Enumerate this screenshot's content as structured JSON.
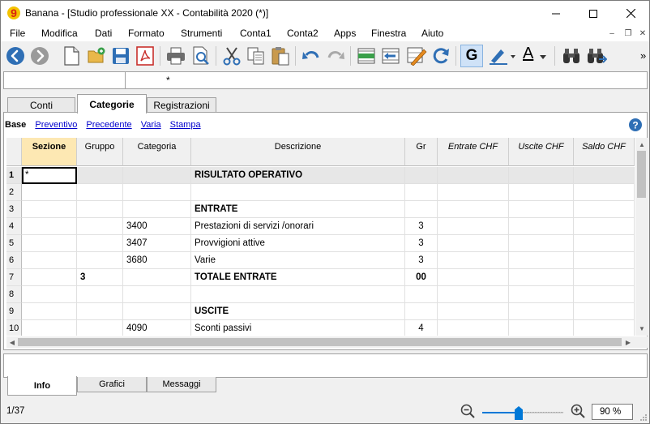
{
  "window": {
    "title": "Banana - [Studio professionale XX - Contabilità 2020 (*)]",
    "logo_glyph": "9"
  },
  "menu": [
    "File",
    "Modifica",
    "Dati",
    "Formato",
    "Strumenti",
    "Conta1",
    "Conta2",
    "Apps",
    "Finestra",
    "Aiuto"
  ],
  "toolbar": {
    "icons": [
      "back-icon",
      "forward-icon",
      "new-file-icon",
      "open-folder-icon",
      "save-icon",
      "pdf-icon",
      "print-icon",
      "print-preview-icon",
      "cut-icon",
      "copy-icon",
      "paste-icon",
      "undo-icon",
      "redo-icon",
      "insert-rows-icon",
      "delete-rows-icon",
      "edit-icon",
      "refresh-icon",
      "bold-icon",
      "highlight-icon",
      "text-color-icon",
      "find-icon",
      "find-next-icon"
    ],
    "bold_label": "G",
    "text_color_label": "A",
    "overflow": "»"
  },
  "cellbar": {
    "value": "*"
  },
  "tabs": [
    {
      "label": "Conti",
      "active": false
    },
    {
      "label": "Categorie",
      "active": true
    },
    {
      "label": "Registrazioni",
      "active": false
    }
  ],
  "views": [
    {
      "label": "Base",
      "current": true
    },
    {
      "label": "Preventivo",
      "current": false
    },
    {
      "label": "Precedente",
      "current": false
    },
    {
      "label": "Varia",
      "current": false
    },
    {
      "label": "Stampa",
      "current": false
    }
  ],
  "columns": [
    "Sezione",
    "Gruppo",
    "Categoria",
    "Descrizione",
    "Gr",
    "Entrate CHF",
    "Uscite CHF",
    "Saldo CHF"
  ],
  "rows": [
    {
      "n": "1",
      "sezione": "*",
      "gruppo": "",
      "categoria": "",
      "descrizione": "RISULTATO OPERATIVO",
      "gr": "",
      "type": "total"
    },
    {
      "n": "2",
      "sezione": "",
      "gruppo": "",
      "categoria": "",
      "descrizione": "",
      "gr": "",
      "type": "normal"
    },
    {
      "n": "3",
      "sezione": "",
      "gruppo": "",
      "categoria": "",
      "descrizione": "ENTRATE",
      "gr": "",
      "type": "heading"
    },
    {
      "n": "4",
      "sezione": "",
      "gruppo": "",
      "categoria": "3400",
      "descrizione": "Prestazioni di servizi /onorari",
      "gr": "3",
      "type": "normal"
    },
    {
      "n": "5",
      "sezione": "",
      "gruppo": "",
      "categoria": "3407",
      "descrizione": "Provvigioni attive",
      "gr": "3",
      "type": "normal"
    },
    {
      "n": "6",
      "sezione": "",
      "gruppo": "",
      "categoria": "3680",
      "descrizione": "Varie",
      "gr": "3",
      "type": "normal"
    },
    {
      "n": "7",
      "sezione": "",
      "gruppo": "3",
      "categoria": "",
      "descrizione": "TOTALE ENTRATE",
      "gr": "00",
      "type": "subtotal"
    },
    {
      "n": "8",
      "sezione": "",
      "gruppo": "",
      "categoria": "",
      "descrizione": "",
      "gr": "",
      "type": "normal"
    },
    {
      "n": "9",
      "sezione": "",
      "gruppo": "",
      "categoria": "",
      "descrizione": "USCITE",
      "gr": "",
      "type": "heading"
    },
    {
      "n": "10",
      "sezione": "",
      "gruppo": "",
      "categoria": "4090",
      "descrizione": "Sconti passivi",
      "gr": "4",
      "type": "normal"
    }
  ],
  "bottom_tabs": [
    {
      "label": "Info",
      "active": true
    },
    {
      "label": "Grafici",
      "active": false
    },
    {
      "label": "Messaggi",
      "active": false
    }
  ],
  "status": {
    "row_counter": "1/37",
    "zoom_label": "90 %",
    "zoom_fraction": 0.45
  },
  "colors": {
    "selection": "#fde8b3",
    "accent": "#0078d7",
    "link": "#0000cc"
  }
}
